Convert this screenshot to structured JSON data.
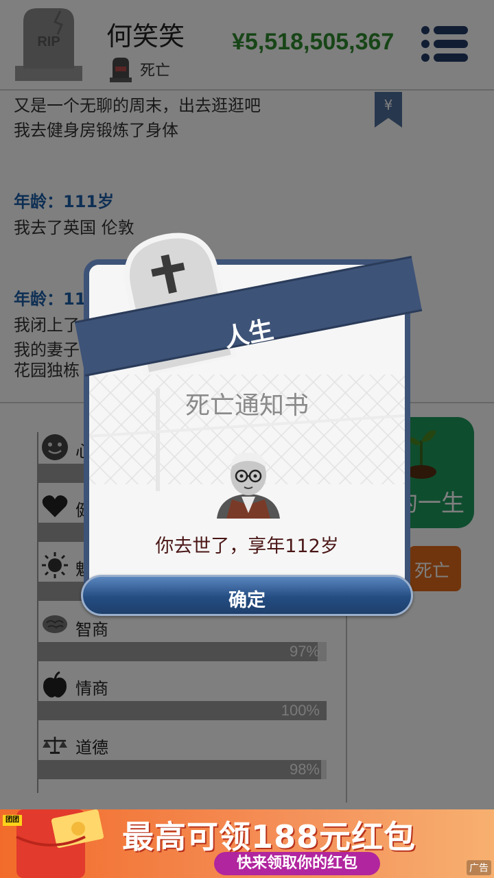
{
  "header": {
    "name": "何笑笑",
    "status": "死亡",
    "money": "¥5,518,505,367",
    "tomb_text": "RIP"
  },
  "log": {
    "lines_top": [
      "又是一个无聊的周末，出去逛逛吧",
      "我去健身房锻炼了身体"
    ],
    "entry1_age": "年龄：111岁",
    "entry1_lines": [
      "我去了英国 伦敦"
    ],
    "entry2_age": "年龄：11",
    "entry2_lines": [
      "我闭上了",
      "我的妻子",
      "花园独栋"
    ],
    "bookmark_symbol": "¥"
  },
  "stats": {
    "items": [
      {
        "label": "心",
        "icon": "smiley-icon"
      },
      {
        "label": "健",
        "icon": "heart-icon"
      },
      {
        "label": "魅",
        "icon": "sun-icon"
      },
      {
        "label": "智商",
        "icon": "brain-icon",
        "percent_label": "97%",
        "percent": 97
      },
      {
        "label": "情商",
        "icon": "apple-icon",
        "percent_label": "100%",
        "percent": 100
      },
      {
        "label": "道德",
        "icon": "scale-icon",
        "percent_label": "98%",
        "percent": 98
      }
    ]
  },
  "side_buttons": {
    "green_label": "的一生",
    "orange_label": "死亡"
  },
  "modal": {
    "ribbon_title": "人生",
    "title": "死亡通知书",
    "message": "你去世了，享年112岁",
    "confirm_label": "确定"
  },
  "ad": {
    "brand": "团团",
    "headline": "最高可领188元红包",
    "sub": "快来领取你的红包",
    "tag": "广告"
  }
}
